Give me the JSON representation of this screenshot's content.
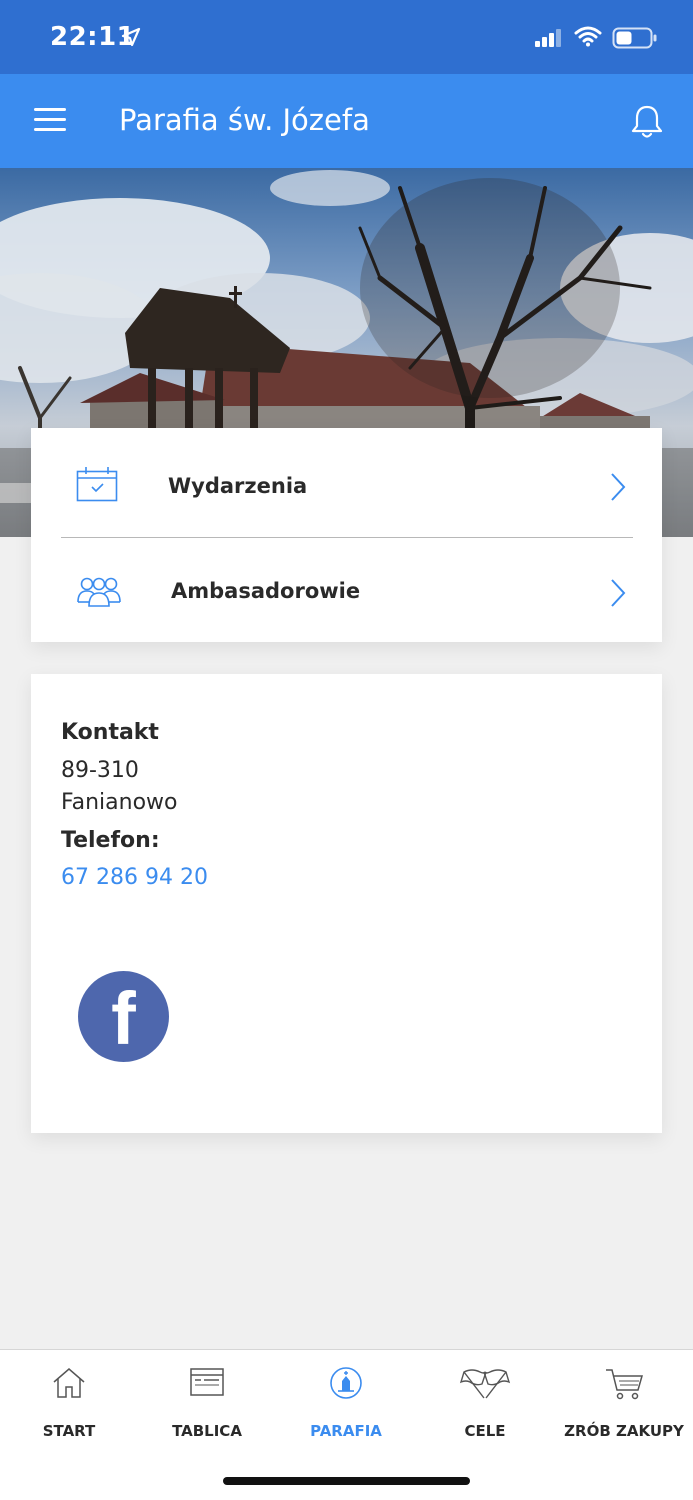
{
  "status_bar": {
    "time": "22:11"
  },
  "app_bar": {
    "title": "Parafia św. Józefa"
  },
  "menu": {
    "items": [
      {
        "label": "Wydarzenia",
        "icon": "calendar-icon"
      },
      {
        "label": "Ambasadorowie",
        "icon": "people-icon"
      }
    ]
  },
  "contact": {
    "heading": "Kontakt",
    "postal_code": "89-310",
    "city": "Fanianowo",
    "phone_label": "Telefon:",
    "phone": "67 286 94 20",
    "social": "facebook-icon"
  },
  "tabs": [
    {
      "label": "START",
      "icon": "home-icon",
      "active": false
    },
    {
      "label": "TABLICA",
      "icon": "board-icon",
      "active": false
    },
    {
      "label": "PARAFIA",
      "icon": "church-icon",
      "active": true
    },
    {
      "label": "CELE",
      "icon": "flags-icon",
      "active": false
    },
    {
      "label": "ZRÓB ZAKUPY",
      "icon": "cart-icon",
      "active": false
    }
  ],
  "colors": {
    "status_bar": "#2f6fd0",
    "app_bar": "#3b8cef",
    "accent": "#3b8cef",
    "facebook": "#4e67ad",
    "background": "#f0f0f0"
  }
}
